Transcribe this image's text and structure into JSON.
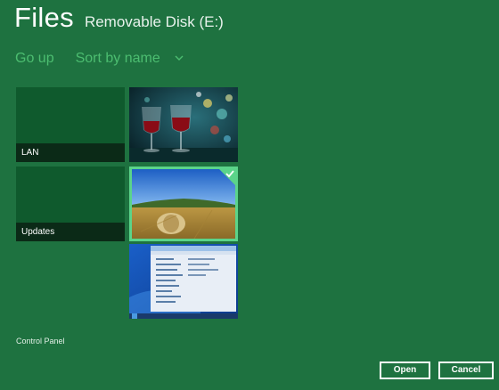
{
  "header": {
    "app_title": "Files",
    "location": "Removable Disk (E:)"
  },
  "commands": {
    "go_up": "Go up",
    "sort": "Sort by name"
  },
  "tiles": [
    {
      "kind": "folder",
      "label": "LAN"
    },
    {
      "kind": "folder",
      "label": "Updates"
    },
    {
      "kind": "image",
      "icon": "wine-glasses-photo"
    },
    {
      "kind": "image",
      "icon": "hay-bale-field-photo",
      "selected": true
    },
    {
      "kind": "image",
      "icon": "windows-control-panel-screenshot"
    }
  ],
  "footer": {
    "folder_name": "Control Panel",
    "open_label": "Open",
    "cancel_label": "Cancel"
  },
  "colors": {
    "background": "#1e7240",
    "accent": "#4cbd70",
    "folder_tile": "#0f5a2d",
    "selection": "#5bd48a"
  }
}
